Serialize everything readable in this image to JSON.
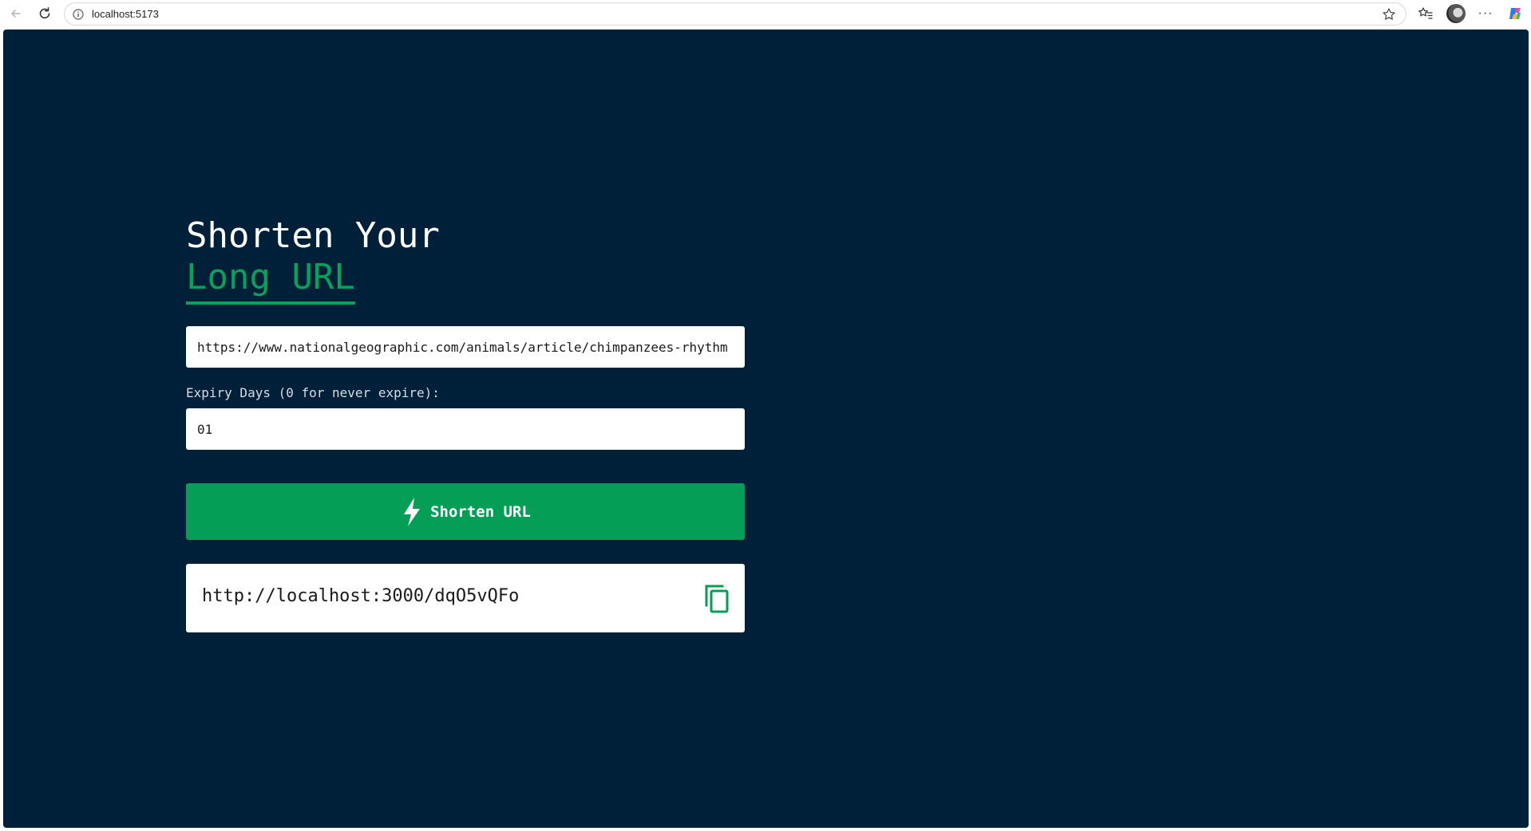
{
  "browser": {
    "address": "localhost:5173",
    "icons": [
      "back-icon",
      "reload-icon",
      "info-icon",
      "star-icon",
      "favorites-icon",
      "avatar",
      "more-icon",
      "copilot-icon"
    ],
    "more_label": "···"
  },
  "page": {
    "headline_line1": "Shorten Your",
    "headline_line2": "Long URL",
    "url_input_value": "https://www.nationalgeographic.com/animals/article/chimpanzees-rhythm",
    "expiry_label": "Expiry Days (0 for never expire):",
    "expiry_value": "01",
    "shorten_button_label": "Shorten URL",
    "result_url": "http://localhost:3000/dqO5vQFo"
  },
  "colors": {
    "background": "#00203a",
    "accent": "#049e56",
    "text_light": "#ffffff"
  }
}
